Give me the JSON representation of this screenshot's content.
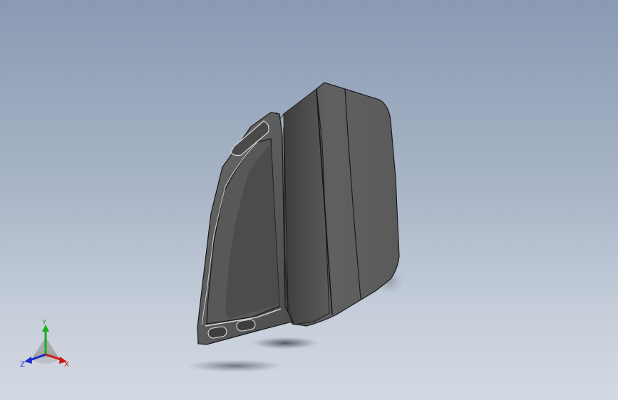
{
  "viewport": {
    "background_top": "#8a9ab3",
    "background_bottom": "#d3d9e2"
  },
  "model": {
    "part_color": "#5c5c5c",
    "edge_color": "#1c1c1c",
    "highlight_color": "#d8d8d8"
  },
  "triad": {
    "x_label": "X",
    "y_label": "Y",
    "z_label": "Z",
    "x_color": "#d01818",
    "y_color": "#18b018",
    "z_color": "#1828d0"
  }
}
